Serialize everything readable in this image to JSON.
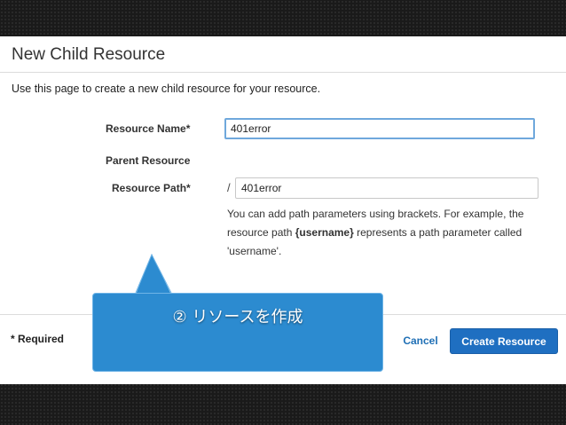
{
  "page": {
    "title": "New Child Resource",
    "description": "Use this page to create a new child resource for your resource."
  },
  "form": {
    "resource_name_label": "Resource Name*",
    "resource_name_value": "401error",
    "parent_resource_label": "Parent Resource",
    "resource_path_label": "Resource Path*",
    "resource_path_prefix": "/",
    "resource_path_value": "401error",
    "help": {
      "line1": "You can add path parameters using brackets. For example, the",
      "line2_before": "resource path ",
      "line2_bold": "{username}",
      "line2_after": " represents a path parameter called",
      "line3": "'username'."
    }
  },
  "footer": {
    "required_note": "* Required",
    "cancel_label": "Cancel",
    "create_label": "Create Resource"
  },
  "callout": {
    "text": "② リソースを作成"
  },
  "colors": {
    "accent": "#1f6fc1",
    "callout": "#2c8bd0",
    "focus_border": "#6fa8dc",
    "link": "#1f6fb5"
  }
}
